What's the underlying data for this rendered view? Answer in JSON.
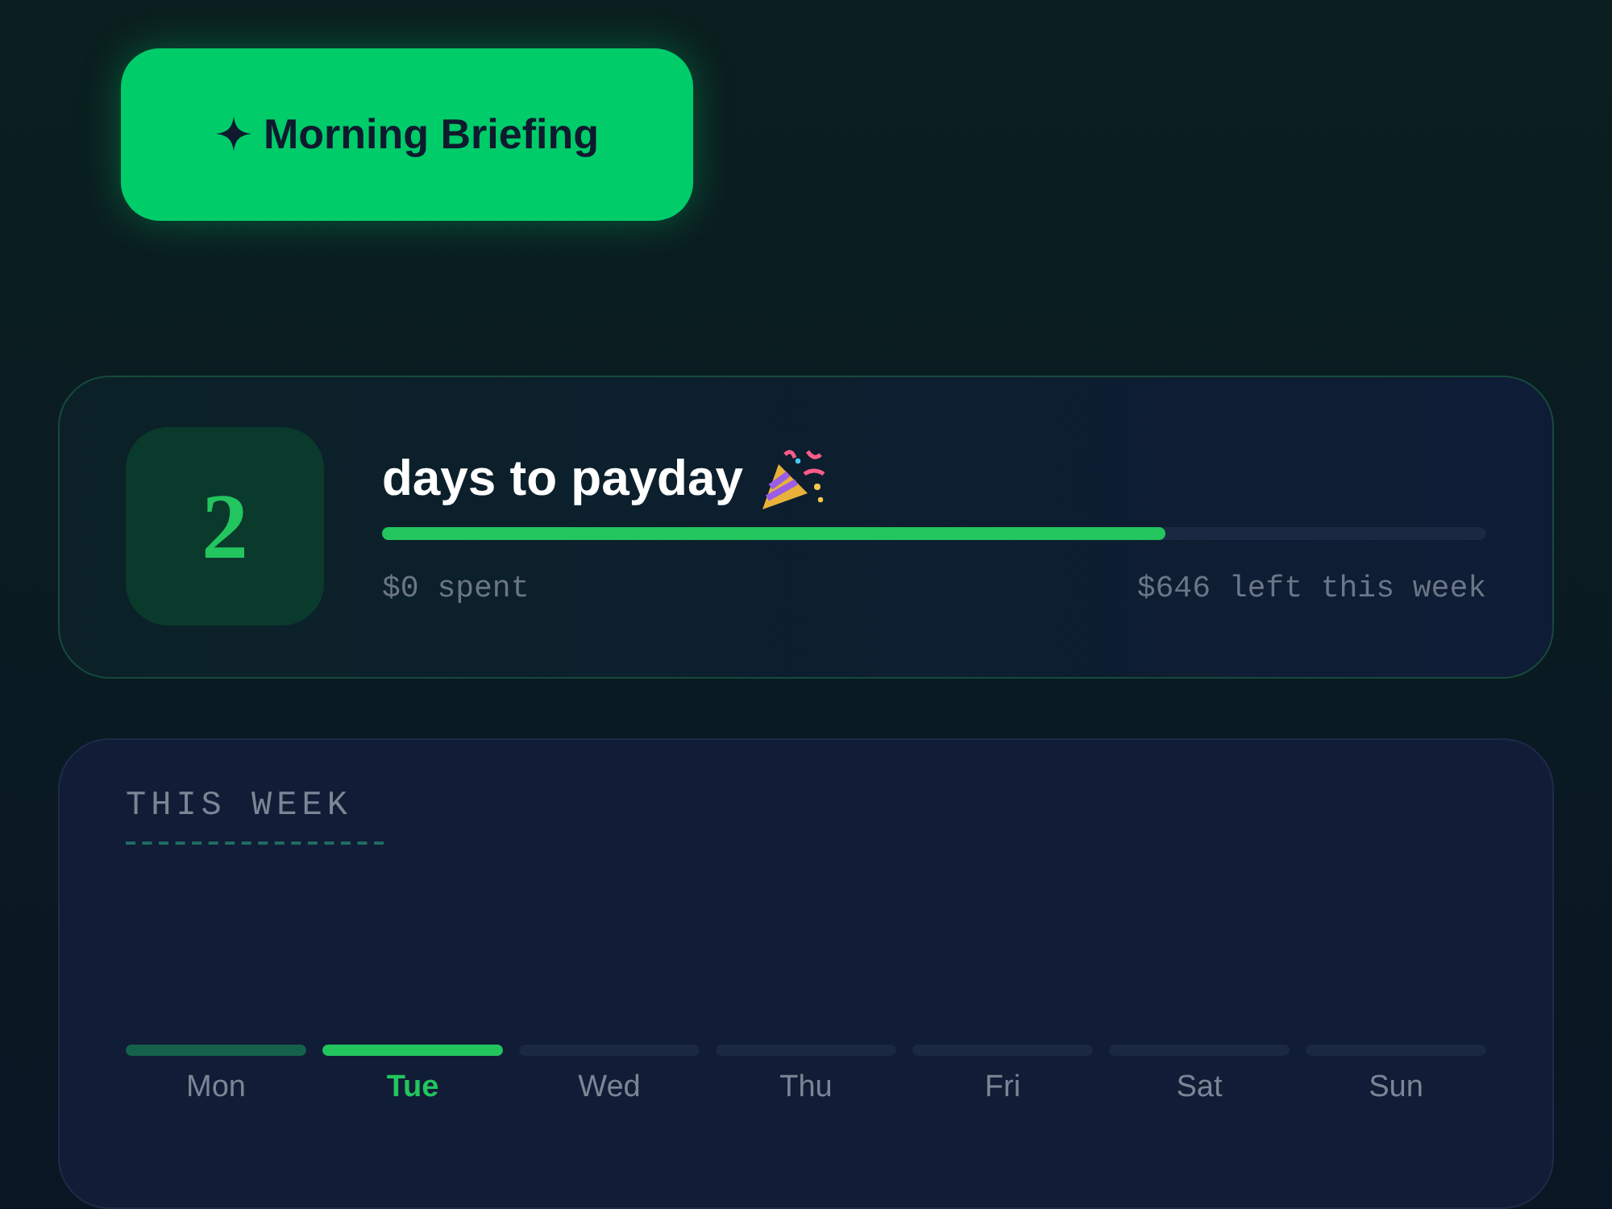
{
  "briefing_button": {
    "label": "Morning Briefing"
  },
  "payday_card": {
    "days": "2",
    "title": "days to payday",
    "level": 0.71,
    "spent": "$0 spent",
    "left": "$646 left this week"
  },
  "week_card": {
    "heading": "THIS WEEK",
    "days": [
      {
        "label": "Mon",
        "kind": "past",
        "selected": false
      },
      {
        "label": "Tue",
        "kind": "today",
        "selected": true
      },
      {
        "label": "Wed",
        "kind": "upcoming",
        "selected": false
      },
      {
        "label": "Thu",
        "kind": "upcoming",
        "selected": false
      },
      {
        "label": "Fri",
        "kind": "upcoming",
        "selected": false
      },
      {
        "label": "Sat",
        "kind": "upcoming",
        "selected": false
      },
      {
        "label": "Sun",
        "kind": "upcoming",
        "selected": false
      }
    ]
  }
}
